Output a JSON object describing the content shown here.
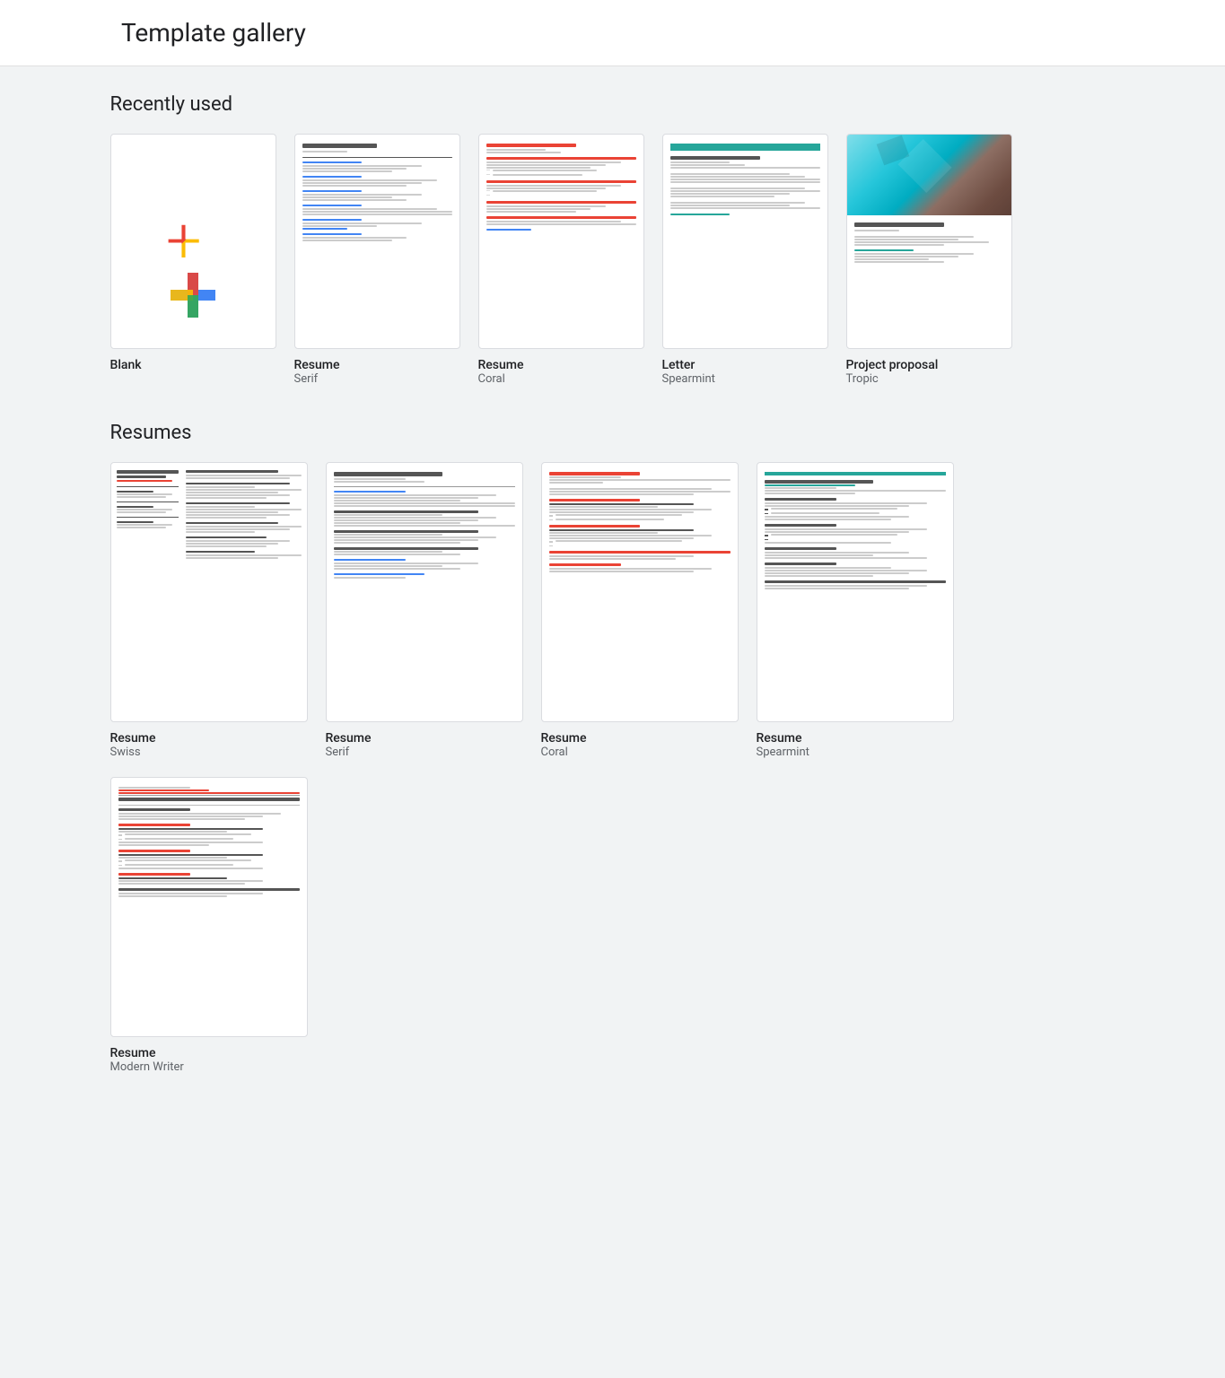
{
  "header": {
    "title": "Template gallery"
  },
  "sections": [
    {
      "id": "recently-used",
      "title": "Recently used",
      "templates": [
        {
          "id": "blank",
          "type": "blank",
          "name": "Blank",
          "subname": ""
        },
        {
          "id": "resume-serif-recent",
          "type": "resume-serif",
          "name": "Resume",
          "subname": "Serif"
        },
        {
          "id": "resume-coral-recent",
          "type": "resume-coral",
          "name": "Resume",
          "subname": "Coral"
        },
        {
          "id": "letter-spearmint",
          "type": "letter-spearmint",
          "name": "Letter",
          "subname": "Spearmint"
        },
        {
          "id": "project-proposal-tropic",
          "type": "project-tropic",
          "name": "Project proposal",
          "subname": "Tropic"
        }
      ]
    },
    {
      "id": "resumes",
      "title": "Resumes",
      "templates": [
        {
          "id": "resume-swiss",
          "type": "resume-swiss",
          "name": "Resume",
          "subname": "Swiss"
        },
        {
          "id": "resume-serif",
          "type": "resume-serif",
          "name": "Resume",
          "subname": "Serif"
        },
        {
          "id": "resume-coral",
          "type": "resume-coral",
          "name": "Resume",
          "subname": "Coral"
        },
        {
          "id": "resume-spearmint",
          "type": "resume-spearmint",
          "name": "Resume",
          "subname": "Spearmint"
        }
      ]
    },
    {
      "id": "resumes-row2",
      "title": "",
      "templates": [
        {
          "id": "resume-modern",
          "type": "resume-modern",
          "name": "Resume",
          "subname": "Modern Writer"
        }
      ]
    }
  ]
}
